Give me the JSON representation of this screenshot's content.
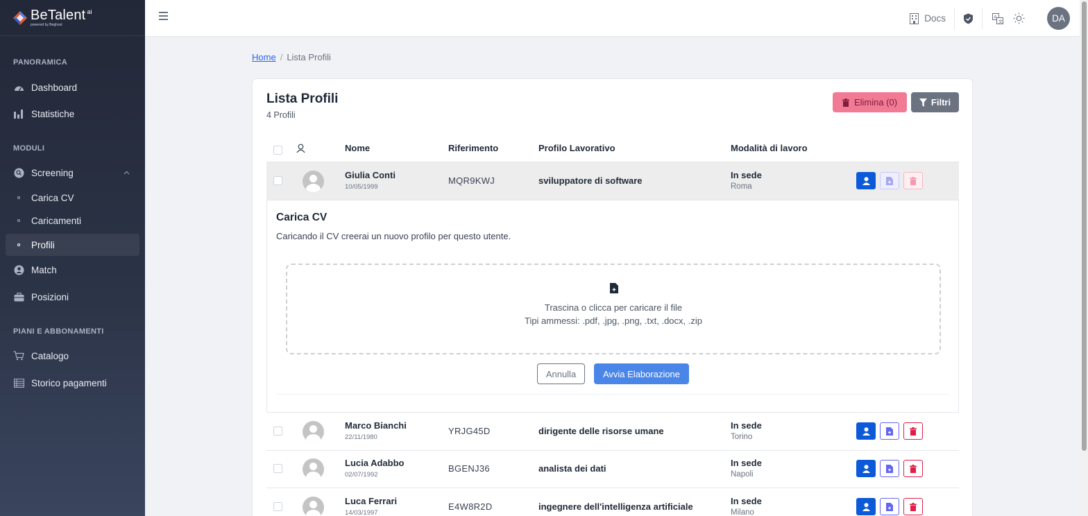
{
  "brand": {
    "name": "BeTalent",
    "sup": "ai",
    "sub": "powered by Beghost"
  },
  "sidebar": {
    "sections": [
      "PANORAMICA",
      "MODULI",
      "PIANI E ABBONAMENTI"
    ],
    "items": [
      {
        "label": "Dashboard",
        "icon": "gauge-icon"
      },
      {
        "label": "Statistiche",
        "icon": "bar-chart-icon"
      },
      {
        "label": "Screening",
        "icon": "screening-icon",
        "expanded": true
      },
      {
        "label": "Carica CV"
      },
      {
        "label": "Caricamenti"
      },
      {
        "label": "Profili",
        "active": true
      },
      {
        "label": "Match",
        "icon": "user-circle-icon"
      },
      {
        "label": "Posizioni",
        "icon": "briefcase-icon"
      },
      {
        "label": "Catalogo",
        "icon": "cart-icon"
      },
      {
        "label": "Storico pagamenti",
        "icon": "ledger-icon"
      }
    ]
  },
  "topbar": {
    "docs_label": "Docs",
    "avatar_initials": "DA"
  },
  "breadcrumb": {
    "home": "Home",
    "current": "Lista Profili"
  },
  "card": {
    "title": "Lista Profili",
    "subtitle": "4 Profili",
    "delete_label": "Elimina (0)",
    "filter_label": "Filtri"
  },
  "table": {
    "headers": [
      "Nome",
      "Riferimento",
      "Profilo Lavorativo",
      "Modalità di lavoro"
    ],
    "rows": [
      {
        "name": "Giulia Conti",
        "dob": "10/05/1999",
        "ref": "MQR9KWJ",
        "job": "sviluppatore di software",
        "mode": "In sede",
        "city": "Roma"
      },
      {
        "name": "Marco Bianchi",
        "dob": "22/11/1980",
        "ref": "YRJG45D",
        "job": "dirigente delle risorse umane",
        "mode": "In sede",
        "city": "Torino"
      },
      {
        "name": "Lucia Adabbo",
        "dob": "02/07/1992",
        "ref": "BGENJ36",
        "job": "analista dei dati",
        "mode": "In sede",
        "city": "Napoli"
      },
      {
        "name": "Luca Ferrari",
        "dob": "14/03/1997",
        "ref": "E4W8R2D",
        "job": "ingegnere dell'intelligenza artificiale",
        "mode": "In sede",
        "city": "Milano"
      }
    ]
  },
  "upload": {
    "title": "Carica CV",
    "description": "Caricando il CV creerai un nuovo profilo per questo utente.",
    "drop_text": "Trascina o clicca per caricare il file",
    "allowed": "Tipi ammessi: .pdf, .jpg, .png, .txt, .docx, .zip",
    "cancel_label": "Annulla",
    "start_label": "Avvia Elaborazione"
  },
  "colors": {
    "primary": "#0d5ad8",
    "danger": "#e11d48",
    "doc": "#6366f1",
    "sidebar": "#2b3346"
  }
}
